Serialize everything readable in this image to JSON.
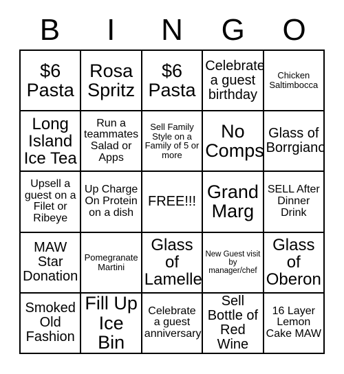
{
  "card": {
    "title": "BINGO",
    "headers": [
      "B",
      "I",
      "N",
      "G",
      "O"
    ],
    "rows": [
      [
        {
          "text": "$6 Pasta",
          "size": "t-xl"
        },
        {
          "text": "Rosa Spritz",
          "size": "t-xl"
        },
        {
          "text": "$6 Pasta",
          "size": "t-xl"
        },
        {
          "text": "Celebrate a guest birthday",
          "size": "t-md"
        },
        {
          "text": "Chicken Saltimbocca",
          "size": "t-xs"
        }
      ],
      [
        {
          "text": "Long Island Ice Tea",
          "size": "t-lg"
        },
        {
          "text": "Run a teammates Salad or Apps",
          "size": "t-sm"
        },
        {
          "text": "Sell Family Style on a Family of 5 or more",
          "size": "t-xs"
        },
        {
          "text": "No Comps",
          "size": "t-xl"
        },
        {
          "text": "Glass of Borrgiano",
          "size": "t-md"
        }
      ],
      [
        {
          "text": "Upsell a guest on a Filet or Ribeye",
          "size": "t-sm"
        },
        {
          "text": "Up Charge On Protein on a dish",
          "size": "t-sm"
        },
        {
          "text": "FREE!!!",
          "size": "t-md"
        },
        {
          "text": "Grand Marg",
          "size": "t-xl"
        },
        {
          "text": "SELL After Dinner Drink",
          "size": "t-sm"
        }
      ],
      [
        {
          "text": "MAW Star Donation",
          "size": "t-md"
        },
        {
          "text": "Pomegranate Martini",
          "size": "t-xs"
        },
        {
          "text": "Glass of Lamelle",
          "size": "t-lg"
        },
        {
          "text": "New Guest visit by manager/chef",
          "size": "t-xxs"
        },
        {
          "text": "Glass of Oberon",
          "size": "t-lg"
        }
      ],
      [
        {
          "text": "Smoked Old Fashion",
          "size": "t-md"
        },
        {
          "text": "Fill Up Ice Bin",
          "size": "t-xl"
        },
        {
          "text": "Celebrate a guest anniversary",
          "size": "t-sm"
        },
        {
          "text": "Sell Bottle of Red Wine",
          "size": "t-md"
        },
        {
          "text": "16 Layer Lemon Cake MAW",
          "size": "t-sm"
        }
      ]
    ],
    "free_space": {
      "row": 2,
      "col": 2
    },
    "colors": {
      "background": "#ffffff",
      "border": "#000000",
      "text": "#000000"
    }
  }
}
